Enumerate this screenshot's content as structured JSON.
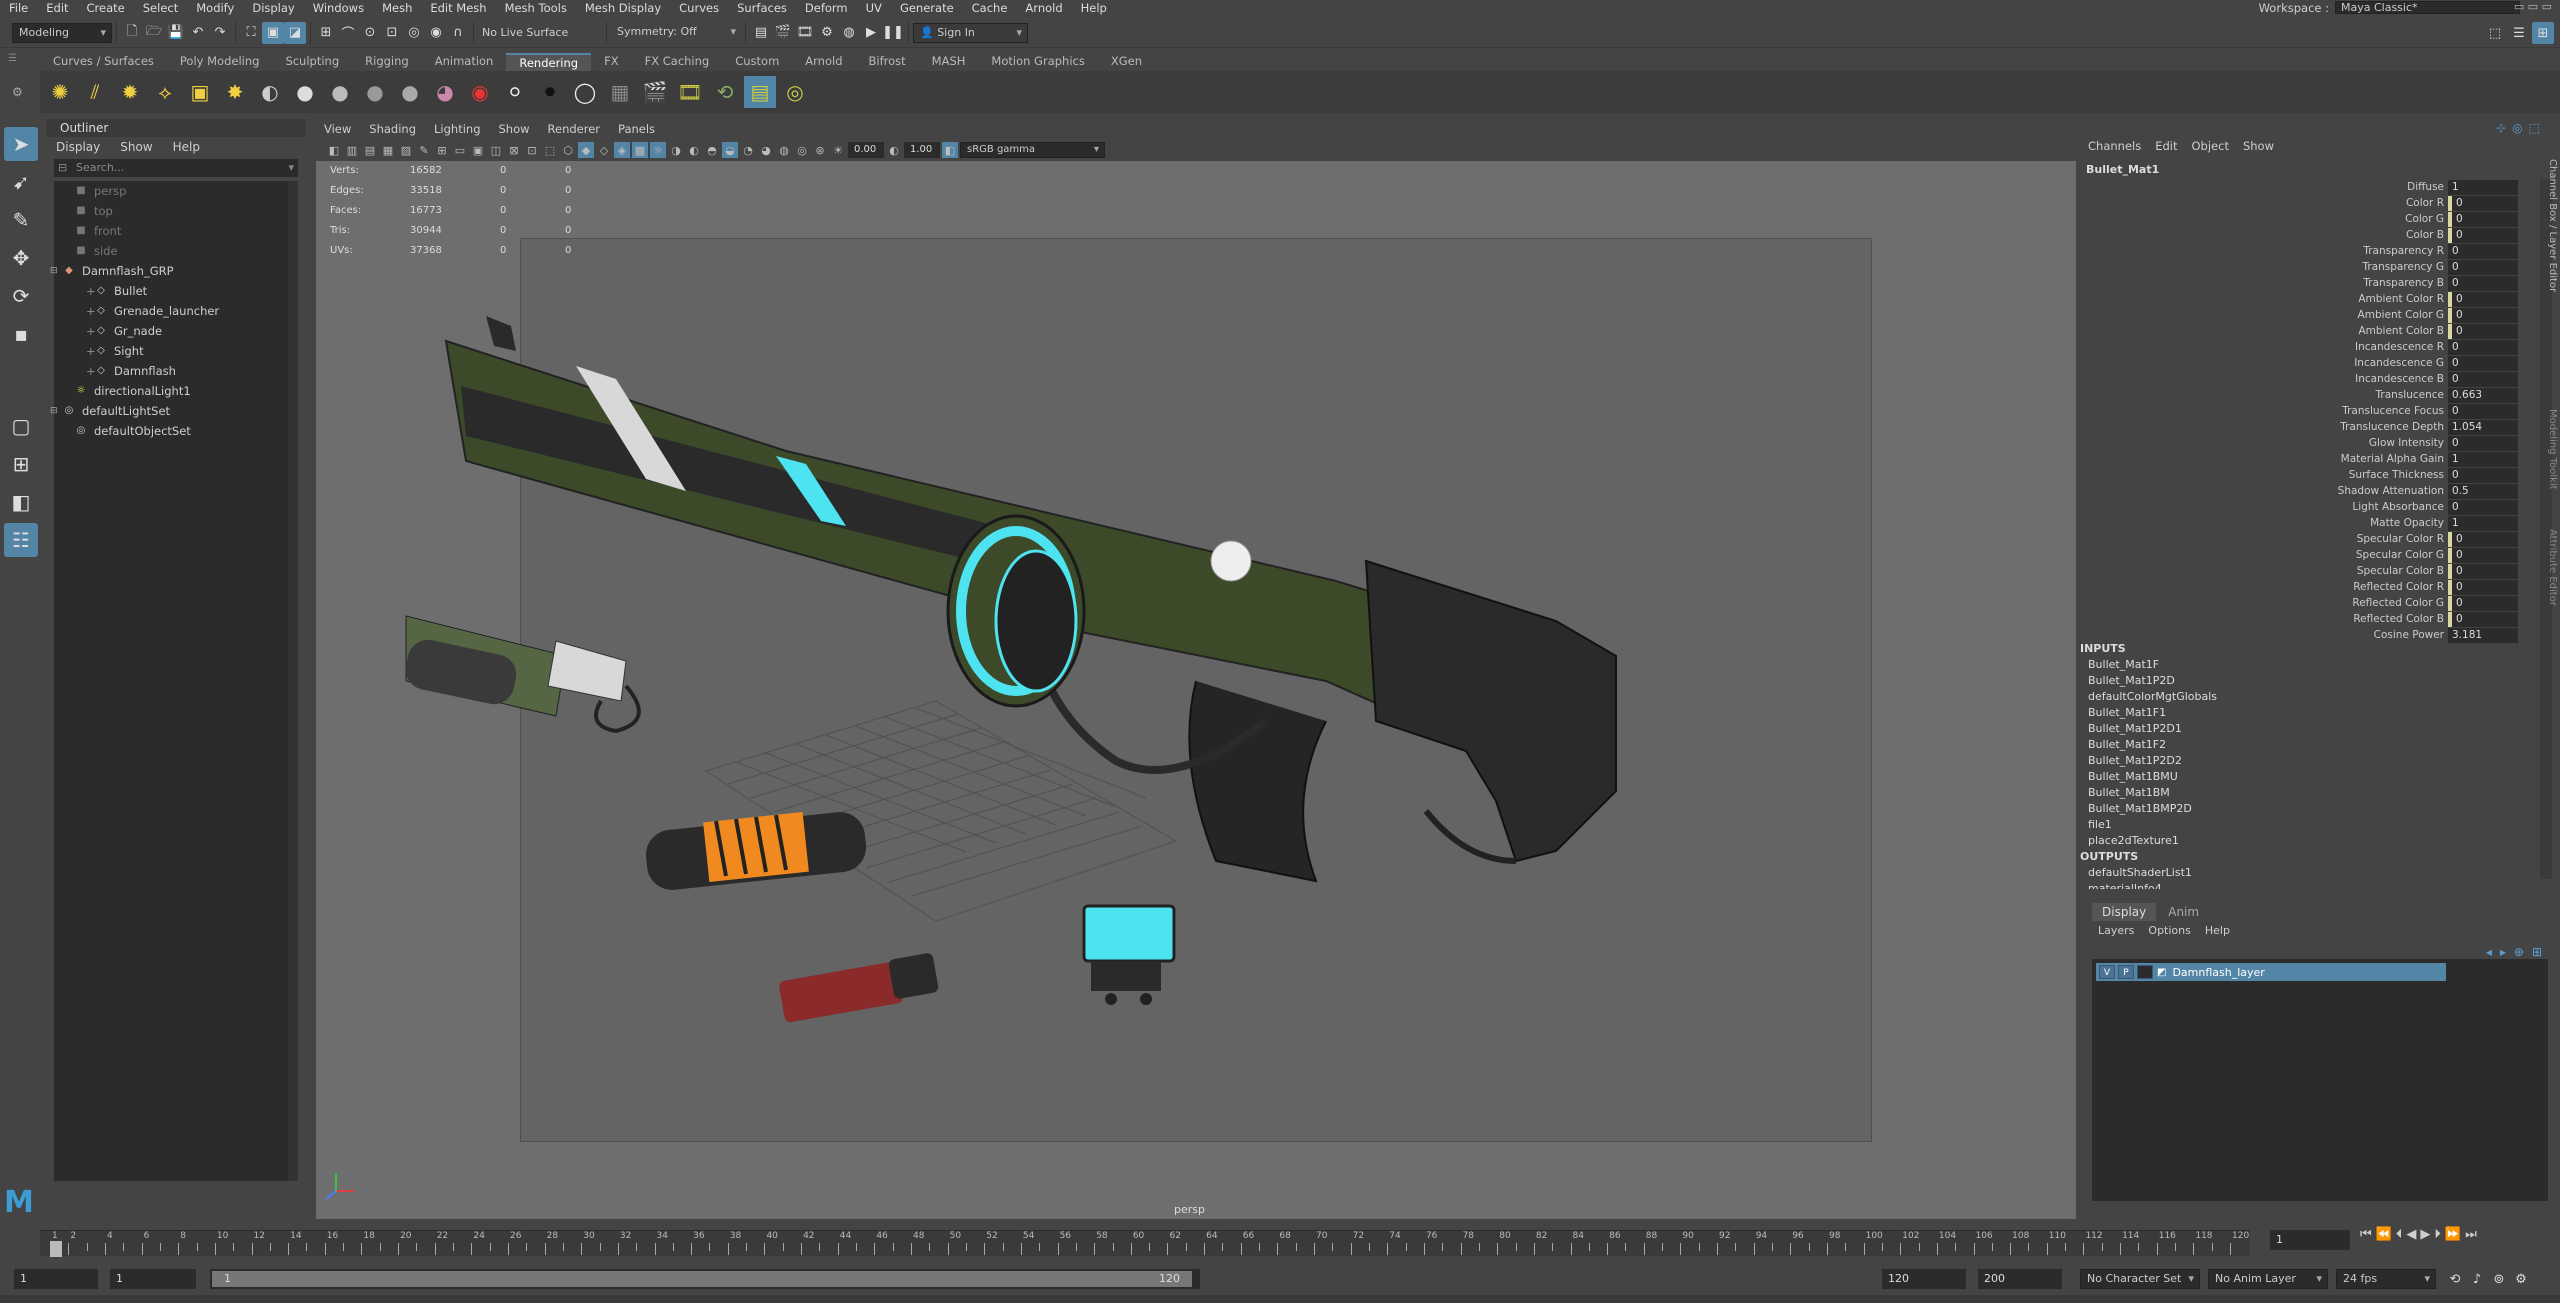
{
  "menubar": {
    "items": [
      "File",
      "Edit",
      "Create",
      "Select",
      "Modify",
      "Display",
      "Windows",
      "Mesh",
      "Edit Mesh",
      "Mesh Tools",
      "Mesh Display",
      "Curves",
      "Surfaces",
      "Deform",
      "UV",
      "Generate",
      "Cache",
      "Arnold",
      "Help"
    ],
    "workspace_label": "Workspace :",
    "workspace_value": "Maya Classic*"
  },
  "statusline": {
    "mode": "Modeling",
    "live_surface": "No Live Surface",
    "symmetry": "Symmetry: Off",
    "sign_in": "Sign In"
  },
  "shelf": {
    "tabs": [
      "Curves / Surfaces",
      "Poly Modeling",
      "Sculpting",
      "Rigging",
      "Animation",
      "Rendering",
      "FX",
      "FX Caching",
      "Custom",
      "Arnold",
      "Bifrost",
      "MASH",
      "Motion Graphics",
      "XGen"
    ],
    "active_tab": "Rendering"
  },
  "outliner": {
    "title": "Outliner",
    "menu": [
      "Display",
      "Show",
      "Help"
    ],
    "search_placeholder": "Search...",
    "items": [
      {
        "label": "persp",
        "icon": "camera-icon",
        "dim": true,
        "indent": 1
      },
      {
        "label": "top",
        "icon": "camera-icon",
        "dim": true,
        "indent": 1
      },
      {
        "label": "front",
        "icon": "camera-icon",
        "dim": true,
        "indent": 1
      },
      {
        "label": "side",
        "icon": "camera-icon",
        "dim": true,
        "indent": 1
      },
      {
        "label": "Damnflash_GRP",
        "icon": "group-icon",
        "dim": false,
        "indent": 0
      },
      {
        "label": "Bullet",
        "icon": "transform-icon",
        "dim": false,
        "indent": 2
      },
      {
        "label": "Grenade_launcher",
        "icon": "transform-icon",
        "dim": false,
        "indent": 2
      },
      {
        "label": "Gr_nade",
        "icon": "transform-icon",
        "dim": false,
        "indent": 2
      },
      {
        "label": "Sight",
        "icon": "transform-icon",
        "dim": false,
        "indent": 2
      },
      {
        "label": "Damnflash",
        "icon": "transform-icon",
        "dim": false,
        "indent": 2
      },
      {
        "label": "directionalLight1",
        "icon": "light-icon",
        "dim": false,
        "indent": 1
      },
      {
        "label": "defaultLightSet",
        "icon": "set-icon",
        "dim": false,
        "indent": 0
      },
      {
        "label": "defaultObjectSet",
        "icon": "set-icon",
        "dim": false,
        "indent": 1
      }
    ]
  },
  "viewport": {
    "menu": [
      "View",
      "Shading",
      "Lighting",
      "Show",
      "Renderer",
      "Panels"
    ],
    "exposure": "0.00",
    "gamma": "1.00",
    "color_space": "sRGB gamma",
    "camera": "persp",
    "hud": [
      {
        "label": "Verts:",
        "a": "16582",
        "b": "0",
        "c": "0"
      },
      {
        "label": "Edges:",
        "a": "33518",
        "b": "0",
        "c": "0"
      },
      {
        "label": "Faces:",
        "a": "16773",
        "b": "0",
        "c": "0"
      },
      {
        "label": "Tris:",
        "a": "30944",
        "b": "0",
        "c": "0"
      },
      {
        "label": "UVs:",
        "a": "37368",
        "b": "0",
        "c": "0"
      }
    ]
  },
  "channelbox": {
    "menu": [
      "Channels",
      "Edit",
      "Object",
      "Show"
    ],
    "node": "Bullet_Mat1",
    "attributes": [
      {
        "name": "Diffuse",
        "value": "1",
        "key": false
      },
      {
        "name": "Color R",
        "value": "0",
        "key": true
      },
      {
        "name": "Color G",
        "value": "0",
        "key": true
      },
      {
        "name": "Color B",
        "value": "0",
        "key": true
      },
      {
        "name": "Transparency R",
        "value": "0",
        "key": false
      },
      {
        "name": "Transparency G",
        "value": "0",
        "key": false
      },
      {
        "name": "Transparency B",
        "value": "0",
        "key": false
      },
      {
        "name": "Ambient Color R",
        "value": "0",
        "key": true
      },
      {
        "name": "Ambient Color G",
        "value": "0",
        "key": true
      },
      {
        "name": "Ambient Color B",
        "value": "0",
        "key": true
      },
      {
        "name": "Incandescence R",
        "value": "0",
        "key": false
      },
      {
        "name": "Incandescence G",
        "value": "0",
        "key": false
      },
      {
        "name": "Incandescence B",
        "value": "0",
        "key": false
      },
      {
        "name": "Translucence",
        "value": "0.663",
        "key": false
      },
      {
        "name": "Translucence Focus",
        "value": "0",
        "key": false
      },
      {
        "name": "Translucence Depth",
        "value": "1.054",
        "key": false
      },
      {
        "name": "Glow Intensity",
        "value": "0",
        "key": false
      },
      {
        "name": "Material Alpha Gain",
        "value": "1",
        "key": false
      },
      {
        "name": "Surface Thickness",
        "value": "0",
        "key": false
      },
      {
        "name": "Shadow Attenuation",
        "value": "0.5",
        "key": false
      },
      {
        "name": "Light Absorbance",
        "value": "0",
        "key": false
      },
      {
        "name": "Matte Opacity",
        "value": "1",
        "key": false
      },
      {
        "name": "Specular Color R",
        "value": "0",
        "key": true
      },
      {
        "name": "Specular Color G",
        "value": "0",
        "key": true
      },
      {
        "name": "Specular Color B",
        "value": "0",
        "key": true
      },
      {
        "name": "Reflected Color R",
        "value": "0",
        "key": true
      },
      {
        "name": "Reflected Color G",
        "value": "0",
        "key": true
      },
      {
        "name": "Reflected Color B",
        "value": "0",
        "key": true
      },
      {
        "name": "Cosine Power",
        "value": "3.181",
        "key": false
      }
    ],
    "inputs_label": "INPUTS",
    "inputs": [
      "Bullet_Mat1F",
      "Bullet_Mat1P2D",
      "defaultColorMgtGlobals",
      "Bullet_Mat1F1",
      "Bullet_Mat1P2D1",
      "Bullet_Mat1F2",
      "Bullet_Mat1P2D2",
      "Bullet_Mat1BMU",
      "Bullet_Mat1BM",
      "Bullet_Mat1BMP2D",
      "file1",
      "place2dTexture1"
    ],
    "outputs_label": "OUTPUTS",
    "outputs": [
      "defaultShaderList1",
      "materialInfo4"
    ]
  },
  "layers": {
    "tabs": [
      "Display",
      "Anim"
    ],
    "active_tab": "Display",
    "menu": [
      "Layers",
      "Options",
      "Help"
    ],
    "layer_name": "Damnflash_layer",
    "v": "V",
    "p": "P"
  },
  "timeline": {
    "current_frame": "1",
    "labels": [
      "1",
      "2",
      "4",
      "6",
      "8",
      "10",
      "12",
      "14",
      "16",
      "18",
      "20",
      "22",
      "24",
      "26",
      "28",
      "30",
      "32",
      "34",
      "36",
      "38",
      "40",
      "42",
      "44",
      "46",
      "48",
      "50",
      "52",
      "54",
      "56",
      "58",
      "60",
      "62",
      "64",
      "66",
      "68",
      "70",
      "72",
      "74",
      "76",
      "78",
      "80",
      "82",
      "84",
      "86",
      "88",
      "90",
      "92",
      "94",
      "96",
      "98",
      "100",
      "102",
      "104",
      "106",
      "108",
      "110",
      "112",
      "114",
      "116",
      "118",
      "120"
    ]
  },
  "range": {
    "start": "1",
    "inner_start": "1",
    "slider_start": "1",
    "slider_end": "120",
    "end": "120",
    "outer_end": "200",
    "character_set": "No Character Set",
    "anim_layer": "No Anim Layer",
    "fps": "24 fps"
  },
  "colors": {
    "accent": "#5285a6",
    "panel": "#444444",
    "field": "#2b2b2b",
    "glow": "#4ee3f0",
    "gun_green": "#3c4a2a"
  }
}
